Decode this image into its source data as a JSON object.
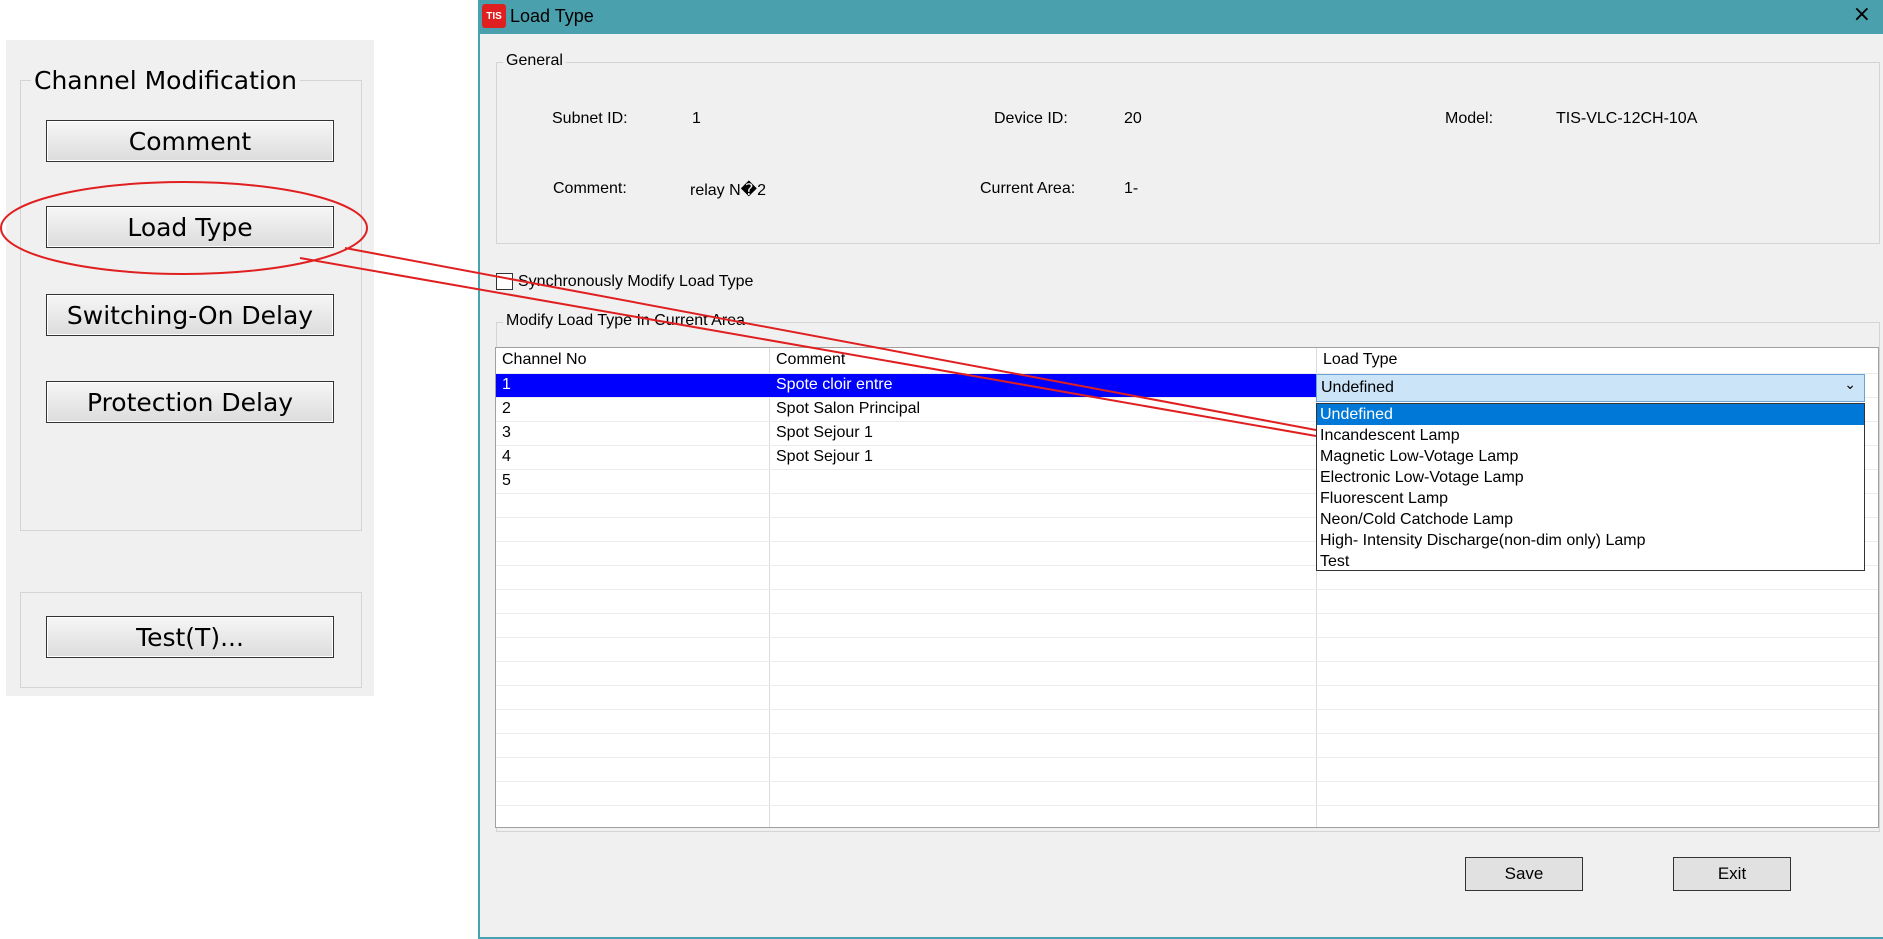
{
  "left_panel": {
    "group_title": "Channel Modification",
    "buttons": [
      "Comment",
      "Load Type",
      "Switching-On Delay",
      "Protection Delay"
    ],
    "test_button": "Test(T)..."
  },
  "dialog": {
    "app_logo": "TIS",
    "title": "Load Type",
    "close_icon": "×",
    "general": {
      "title": "General",
      "subnet_label": "Subnet ID:",
      "subnet_value": "1",
      "device_label": "Device ID:",
      "device_value": "20",
      "model_label": "Model:",
      "model_value": "TIS-VLC-12CH-10A",
      "comment_label": "Comment:",
      "comment_value": "relay N�2",
      "area_label": "Current Area:",
      "area_value": "1-"
    },
    "sync_checkbox_label": "Synchronously Modify Load Type",
    "sync_checked": false,
    "modify_group_title": "Modify Load Type In Current Area",
    "grid": {
      "headers": [
        "Channel No",
        "Comment",
        "Load Type"
      ],
      "rows": [
        {
          "channel": "1",
          "comment": "Spote cloir entre"
        },
        {
          "channel": "2",
          "comment": "Spot Salon Principal"
        },
        {
          "channel": "3",
          "comment": "Spot Sejour 1"
        },
        {
          "channel": "4",
          "comment": "Spot Sejour 1"
        },
        {
          "channel": "5",
          "comment": ""
        }
      ]
    },
    "combo": {
      "value": "Undefined",
      "arrow": "⌄",
      "options": [
        "Undefined",
        "Incandescent Lamp",
        "Magnetic Low-Votage Lamp",
        "Electronic Low-Votage Lamp",
        "Fluorescent Lamp",
        "Neon/Cold Catchode Lamp",
        "High- Intensity Discharge(non-dim only) Lamp",
        "Test"
      ]
    },
    "save_label": "Save",
    "exit_label": "Exit"
  },
  "colors": {
    "titlebar": "#4ba0ad",
    "selection": "#0000ff",
    "dropdown_selection": "#0078d7",
    "annotation": "#e02020"
  },
  "icons": {
    "app_logo": "tis-logo-icon",
    "close": "close-icon",
    "dropdown": "chevron-down-icon"
  }
}
